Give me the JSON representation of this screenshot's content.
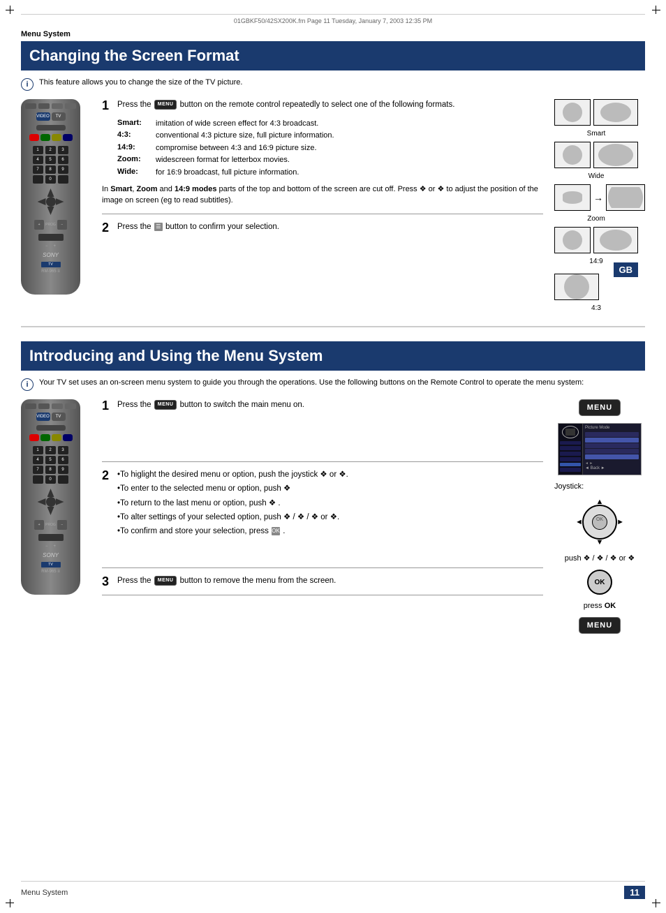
{
  "page": {
    "file_info": "01GBKF50/42SX200K.fm  Page 11  Tuesday, January 7, 2003  12:35 PM",
    "section": "Menu System",
    "footer_section": "Menu System",
    "page_number": "11",
    "gb_badge": "GB"
  },
  "section1": {
    "title": "Changing the Screen Format",
    "info_text": "This feature allows you to change the size of the TV picture.",
    "step1_text": "Press the  button on the remote control repeatedly to select one of the following formats.",
    "formats": [
      {
        "label": "Smart:",
        "desc": "imitation of wide screen effect for 4:3 broadcast."
      },
      {
        "label": "4:3:",
        "desc": "conventional 4:3 picture size, full picture information."
      },
      {
        "label": "14:9:",
        "desc": "compromise between 4:3 and 16:9 picture size."
      },
      {
        "label": "Zoom:",
        "desc": "widescreen format for letterbox movies."
      },
      {
        "label": "Wide:",
        "desc": "for 16:9 broadcast, full picture information."
      }
    ],
    "smart_zoom_note": "In Smart, Zoom and 14:9 modes parts of the top and bottom of the screen are cut off. Press ❖ or ❖ to adjust the position of the image on screen (eg to read subtitles).",
    "step2_text": "Press the  button to confirm your selection.",
    "illustrations": [
      {
        "label": "Smart",
        "type": "smart"
      },
      {
        "label": "Wide",
        "type": "wide"
      },
      {
        "label": "Zoom",
        "type": "zoom"
      },
      {
        "label": "14:9",
        "type": "fourteen9"
      },
      {
        "label": "4:3",
        "type": "four3"
      }
    ]
  },
  "section2": {
    "title": "Introducing and Using the Menu System",
    "info_text": "Your TV set uses an on-screen menu system to guide you through the operations. Use the following buttons on the Remote Control to operate the menu system:",
    "step1_text": "Press the  button to switch the main menu on.",
    "step2_intro": "",
    "step2_bullets": [
      "•To higlight the desired menu or option, push the joystick ❖ or ❖.",
      "•To enter to the selected menu or option, push ❖",
      "•To return to the last menu or option, push  ❖ .",
      "•To alter settings of your selected option, push ❖ / ❖ / ❖ or ❖.",
      "•To confirm and store your selection, press  ."
    ],
    "step3_text": "Press the  button to remove the menu from the screen.",
    "joystick_label": "Joystick:",
    "joystick_push_text": "push ❖ / ❖ / ❖ or ❖",
    "press_ok_text": "press OK"
  }
}
